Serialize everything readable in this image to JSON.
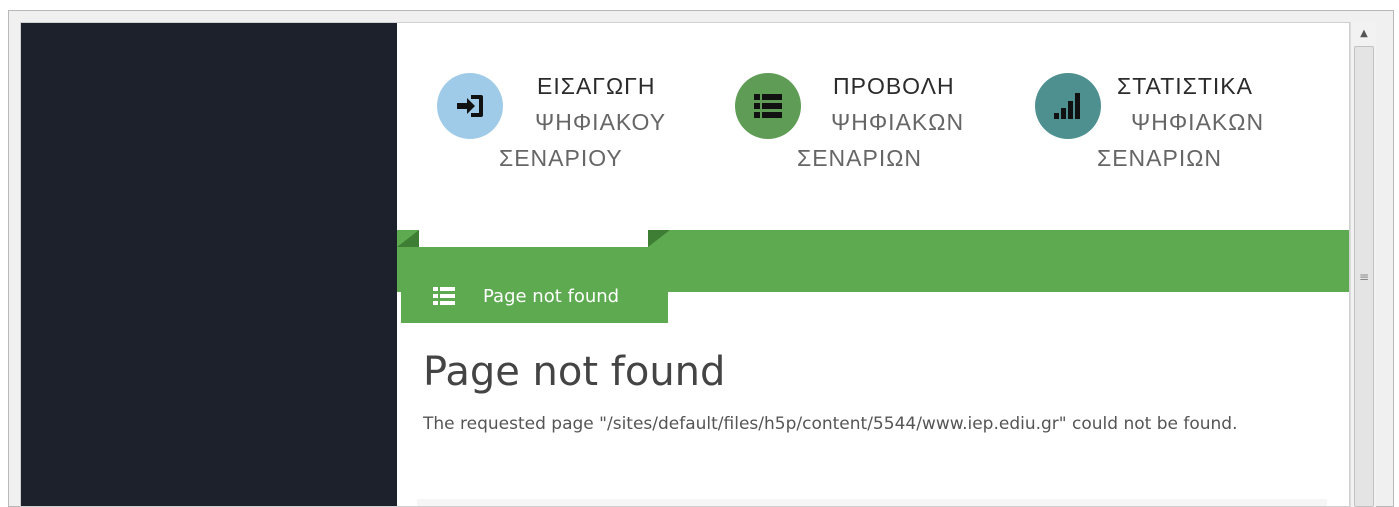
{
  "nav": {
    "items": [
      {
        "line1": "ΕΙΣΑΓΩΓΗ",
        "line2": "ΨΗΦΙΑΚΟΥ",
        "line3": "ΣΕΝΑΡΙΟΥ",
        "icon": "sign-in-icon",
        "color": "#9fcbe8"
      },
      {
        "line1": "ΠΡΟΒΟΛΗ",
        "line2": "ΨΗΦΙΑΚΩΝ",
        "line3": "ΣΕΝΑΡΙΩΝ",
        "icon": "list-icon",
        "color": "#5f9c55"
      },
      {
        "line1": "ΣΤΑΤΙΣΤΙΚΑ",
        "line2": "ΨΗΦΙΑΚΩΝ",
        "line3": "ΣΕΝΑΡΙΩΝ",
        "icon": "signal-bars-icon",
        "color": "#4e9090"
      }
    ]
  },
  "tab": {
    "label": "Page not found",
    "icon": "list-icon"
  },
  "content": {
    "title": "Page not found",
    "description": "The requested page \"/sites/default/files/h5p/content/5544/www.iep.ediu.gr\" could not be found."
  },
  "colors": {
    "sidebar": "#1d212b",
    "accent_green": "#5daa50"
  }
}
